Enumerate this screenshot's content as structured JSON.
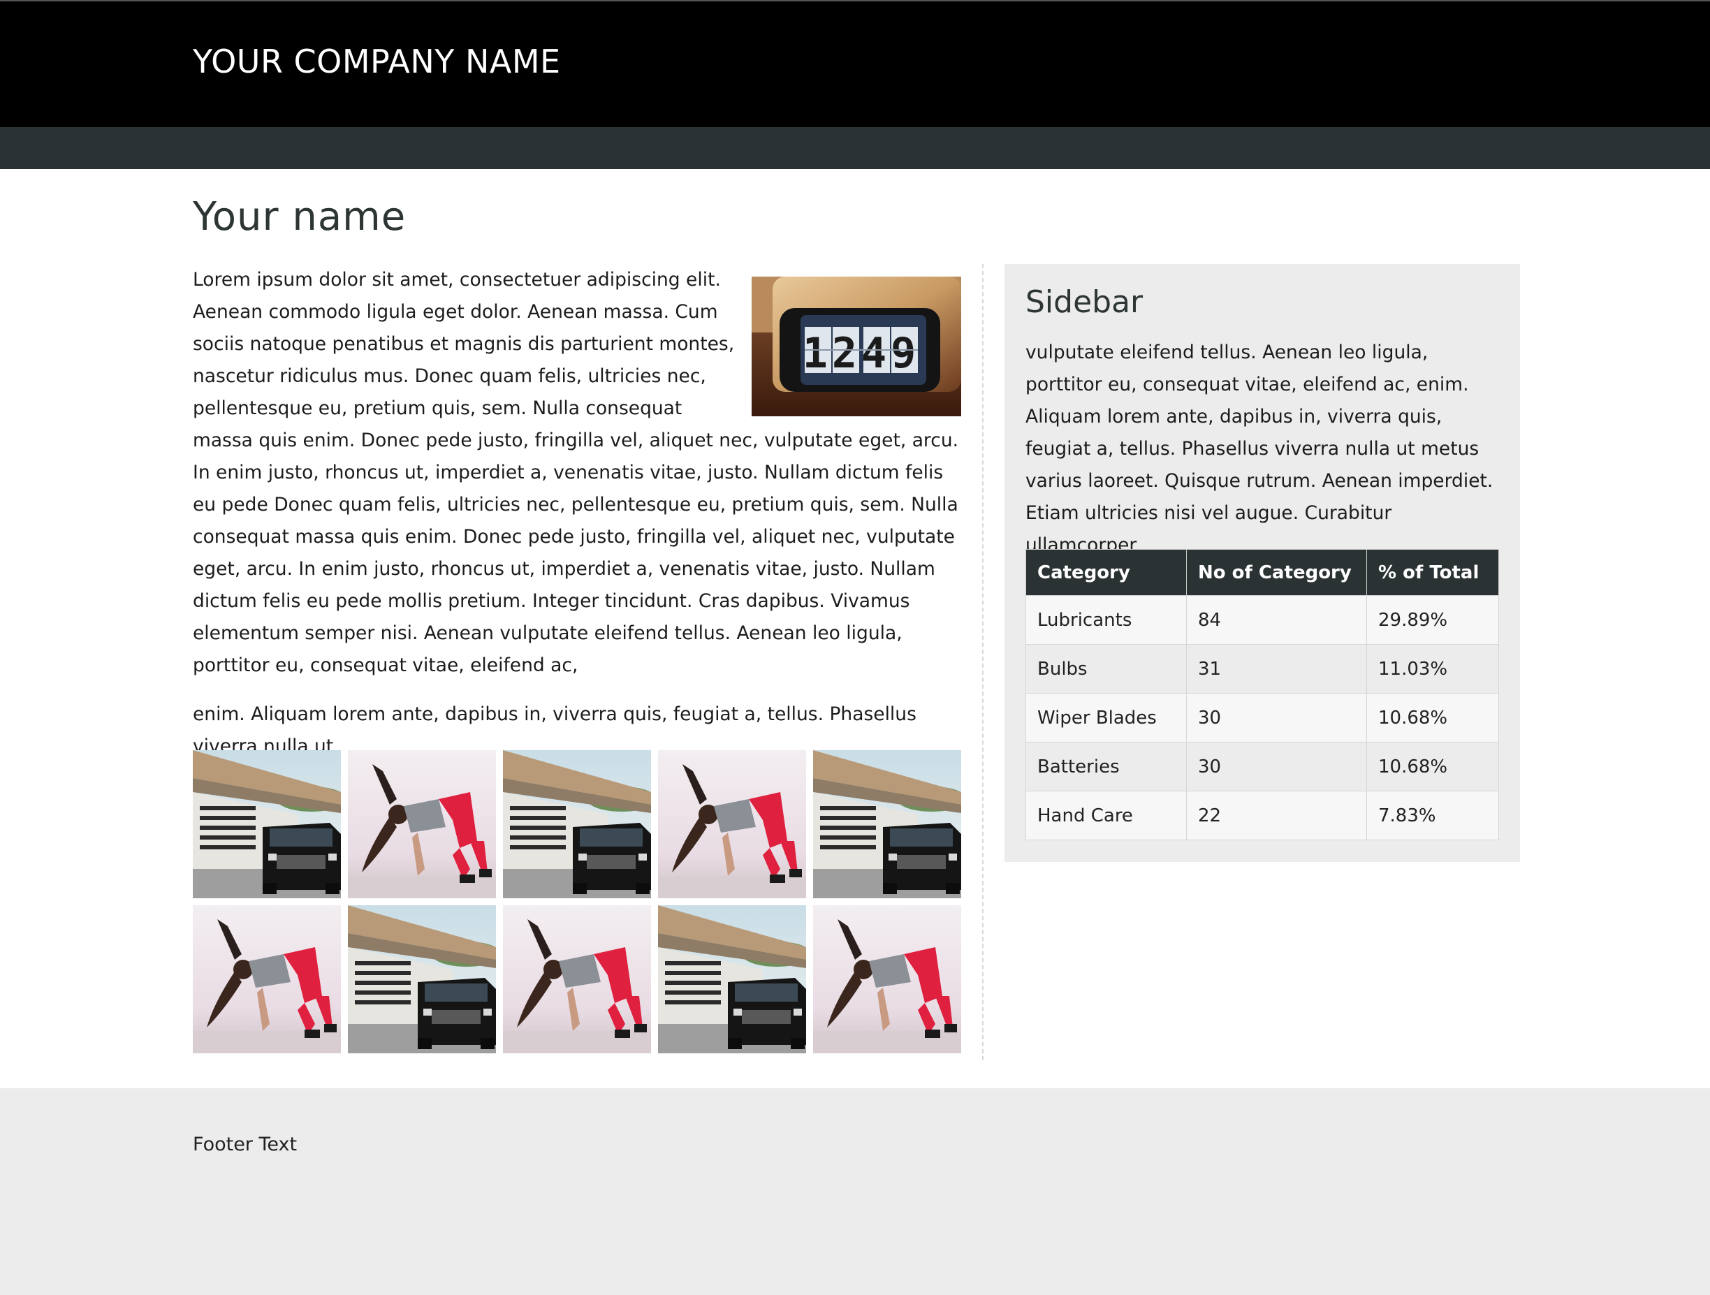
{
  "header": {
    "company_name": "YOUR COMPANY NAME"
  },
  "main": {
    "title": "Your name",
    "paragraph1": "Lorem ipsum dolor sit amet, consectetuer adipiscing elit. Aenean commodo ligula eget dolor. Aenean massa. Cum sociis natoque penatibus et magnis dis parturient montes, nascetur ridiculus mus. Donec quam felis, ultricies nec, pellentesque eu, pretium quis, sem. Nulla consequat massa quis enim. Donec pede justo, fringilla vel, aliquet nec, vulputate eget, arcu. In enim justo, rhoncus ut, imperdiet a, venenatis vitae, justo. Nullam dictum felis eu pede Donec quam felis, ultricies nec, pellentesque eu, pretium quis, sem. Nulla consequat massa quis enim. Donec pede justo, fringilla vel, aliquet nec, vulputate eget, arcu. In enim justo, rhoncus ut, imperdiet a, venenatis vitae, justo. Nullam dictum felis eu pede mollis pretium. Integer tincidunt. Cras dapibus. Vivamus elementum semper nisi. Aenean vulputate eleifend tellus. Aenean leo ligula, porttitor eu, consequat vitae, eleifend ac,",
    "paragraph2": "enim. Aliquam lorem ante, dapibus in, viverra quis, feugiat a, tellus. Phasellus viverra nulla ut",
    "clock_digits": "1249",
    "gallery": [
      "car",
      "dancer",
      "car",
      "dancer",
      "car",
      "dancer",
      "car",
      "dancer",
      "car",
      "dancer"
    ]
  },
  "sidebar": {
    "title": "Sidebar",
    "text": "vulputate eleifend tellus. Aenean leo ligula, porttitor eu, consequat vitae, eleifend ac, enim. Aliquam lorem ante, dapibus in, viverra quis, feugiat a, tellus. Phasellus viverra nulla ut metus varius laoreet. Quisque rutrum. Aenean imperdiet. Etiam ultricies nisi vel augue. Curabitur ullamcorper",
    "table": {
      "headers": [
        "Category",
        "No of Category",
        "% of Total"
      ],
      "rows": [
        [
          "Lubricants",
          "84",
          "29.89%"
        ],
        [
          "Bulbs",
          "31",
          "11.03%"
        ],
        [
          "Wiper Blades",
          "30",
          "10.68%"
        ],
        [
          "Batteries",
          "30",
          "10.68%"
        ],
        [
          "Hand Care",
          "22",
          "7.83%"
        ]
      ]
    }
  },
  "footer": {
    "text": "Footer Text"
  },
  "colors": {
    "header_bg": "#000000",
    "nav_bg": "#2b3233",
    "sidebar_bg": "#ececec",
    "footer_bg": "#ececec",
    "table_head_bg": "#2b3233"
  }
}
